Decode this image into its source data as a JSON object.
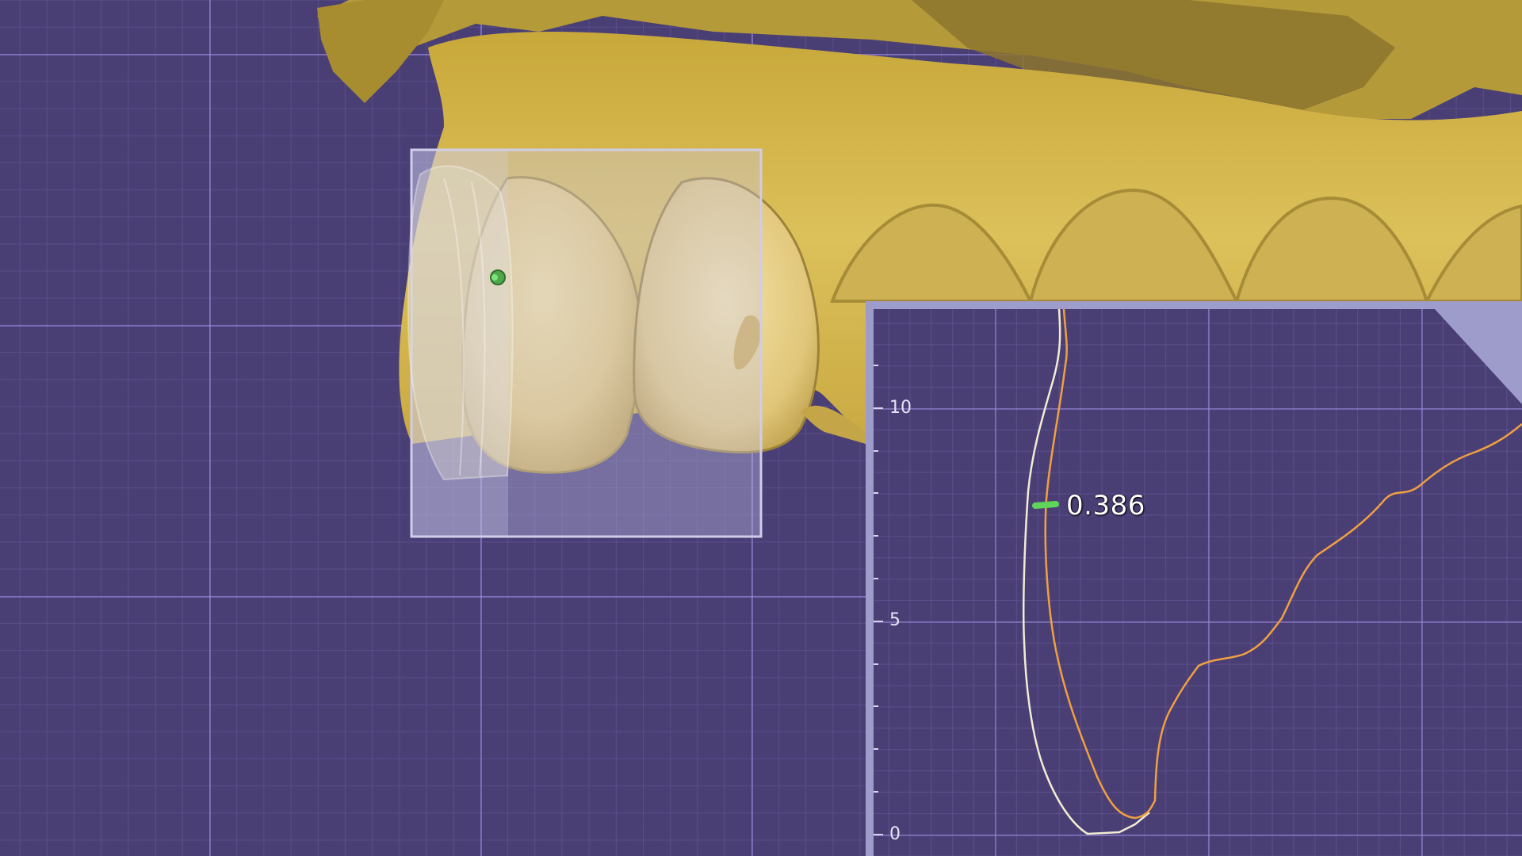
{
  "viewport": {
    "background_color": "#4a3f75",
    "model_color": "#d9bc55"
  },
  "profile_panel": {
    "y_axis_ticks": [
      "10",
      "5",
      "0"
    ],
    "measurement": {
      "value": "0.386",
      "marker_color": "#5fd35a"
    },
    "curve_colors": {
      "inner": "#f2ecd2",
      "outer": "#f0a040"
    }
  }
}
